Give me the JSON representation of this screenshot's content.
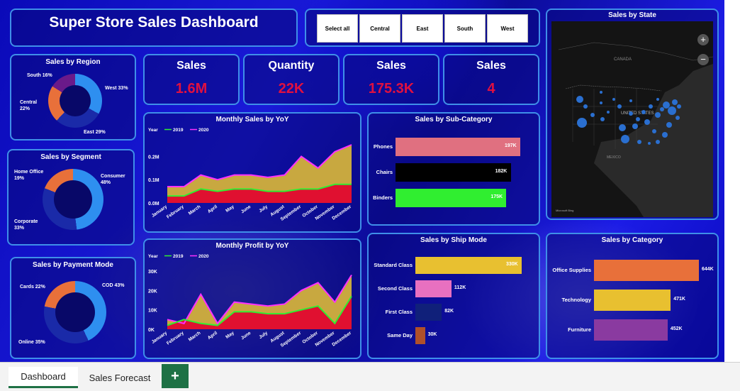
{
  "dashboard": {
    "title": "Super Store Sales Dashboard"
  },
  "slicer": {
    "buttons": [
      "Select all",
      "Central",
      "East",
      "South",
      "West"
    ]
  },
  "kpis": [
    {
      "label": "Sales",
      "value": "1.6M"
    },
    {
      "label": "Quantity",
      "value": "22K"
    },
    {
      "label": "Sales",
      "value": "175.3K"
    },
    {
      "label": "Sales",
      "value": "4"
    }
  ],
  "region": {
    "title": "Sales by Region",
    "slices": [
      {
        "label": "West 33%",
        "pct": 33,
        "color": "#2e8ff0"
      },
      {
        "label": "East 29%",
        "pct": 29,
        "color": "#1a2aa8"
      },
      {
        "label": "Central 22%",
        "pct": 22,
        "color": "#e8703a"
      },
      {
        "label": "South 16%",
        "pct": 16,
        "color": "#6a1a8a"
      }
    ]
  },
  "segment": {
    "title": "Sales by Segment",
    "slices": [
      {
        "label": "Consumer 48%",
        "pct": 48,
        "color": "#2e8ff0"
      },
      {
        "label": "Corporate 33%",
        "pct": 33,
        "color": "#1a2aa8"
      },
      {
        "label": "Home Office 19%",
        "pct": 19,
        "color": "#e8703a"
      }
    ]
  },
  "payment": {
    "title": "Sales by Payment Mode",
    "slices": [
      {
        "label": "COD 43%",
        "pct": 43,
        "color": "#2e8ff0"
      },
      {
        "label": "Online 35%",
        "pct": 35,
        "color": "#1a2aa8"
      },
      {
        "label": "Cards 22%",
        "pct": 22,
        "color": "#e8703a"
      }
    ]
  },
  "subcategory": {
    "title": "Sales by Sub-Category",
    "bars": [
      {
        "label": "Phones",
        "value": "197K",
        "num": 197,
        "color": "#e07080"
      },
      {
        "label": "Chairs",
        "value": "182K",
        "num": 182,
        "color": "#000000"
      },
      {
        "label": "Binders",
        "value": "175K",
        "num": 175,
        "color": "#30ee30"
      }
    ]
  },
  "shipmode": {
    "title": "Sales by Ship Mode",
    "bars": [
      {
        "label": "Standard Class",
        "value": "330K",
        "num": 330,
        "color": "#e8c030"
      },
      {
        "label": "Second Class",
        "value": "112K",
        "num": 112,
        "color": "#e870c0"
      },
      {
        "label": "First Class",
        "value": "82K",
        "num": 82,
        "color": "#10207a"
      },
      {
        "label": "Same Day",
        "value": "30K",
        "num": 30,
        "color": "#b0502a"
      }
    ]
  },
  "category": {
    "title": "Sales by Category",
    "bars": [
      {
        "label": "Office Supplies",
        "value": "644K",
        "num": 644,
        "color": "#e8703a"
      },
      {
        "label": "Technology",
        "value": "471K",
        "num": 471,
        "color": "#e8c030"
      },
      {
        "label": "Furniture",
        "value": "452K",
        "num": 452,
        "color": "#8a3aa0"
      }
    ]
  },
  "map": {
    "title": "Sales by State",
    "zoom_in": "+",
    "zoom_out": "−",
    "labels": {
      "canada": "CANADA",
      "us": "UNITED STATES",
      "mexico": "MEXICO"
    },
    "attribution": "Microsoft Bing"
  },
  "tabs": {
    "items": [
      "Dashboard",
      "Sales Forecast"
    ],
    "add_label": "+"
  },
  "chart_data": [
    {
      "type": "area",
      "title": "Monthly Sales by YoY",
      "legend_title": "Year",
      "x": [
        "January",
        "February",
        "March",
        "April",
        "May",
        "June",
        "July",
        "August",
        "September",
        "October",
        "November",
        "December"
      ],
      "y_ticks": [
        "0.0M",
        "0.1M",
        "0.2M"
      ],
      "ylim": [
        0,
        0.25
      ],
      "series": [
        {
          "name": "2019",
          "color": "#30ee30",
          "values": [
            0.03,
            0.03,
            0.06,
            0.05,
            0.06,
            0.06,
            0.05,
            0.05,
            0.06,
            0.06,
            0.08,
            0.08
          ]
        },
        {
          "name": "2020",
          "color": "#ff30ff",
          "values": [
            0.07,
            0.07,
            0.12,
            0.1,
            0.12,
            0.12,
            0.11,
            0.12,
            0.2,
            0.15,
            0.22,
            0.25
          ]
        }
      ]
    },
    {
      "type": "area",
      "title": "Monthly Profit by YoY",
      "legend_title": "Year",
      "x": [
        "January",
        "February",
        "March",
        "April",
        "May",
        "June",
        "July",
        "August",
        "September",
        "October",
        "November",
        "December"
      ],
      "y_ticks": [
        "0K",
        "10K",
        "20K",
        "30K"
      ],
      "ylim": [
        0,
        30
      ],
      "series": [
        {
          "name": "2019",
          "color": "#30ee30",
          "values": [
            2,
            5,
            3,
            2,
            9,
            9,
            8,
            8,
            10,
            12,
            3,
            17
          ]
        },
        {
          "name": "2020",
          "color": "#ff30ff",
          "values": [
            5,
            3,
            18,
            3,
            14,
            13,
            12,
            13,
            20,
            24,
            14,
            28
          ]
        }
      ]
    }
  ]
}
